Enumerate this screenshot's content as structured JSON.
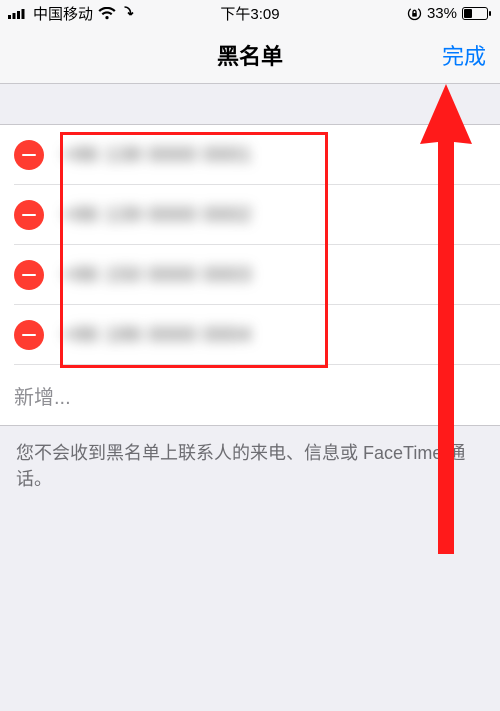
{
  "status": {
    "carrier": "中国移动",
    "time": "下午3:09",
    "battery_pct": "33%"
  },
  "nav": {
    "title": "黑名单",
    "done_label": "完成"
  },
  "list": {
    "items": [
      {
        "text": "+86 138 0000 0001"
      },
      {
        "text": "+86 139 0000 0002"
      },
      {
        "text": "+86 150 0000 0003"
      },
      {
        "text": "+86 186 0000 0004"
      }
    ],
    "add_label": "新增..."
  },
  "footer": {
    "note": "您不会收到黑名单上联系人的来电、信息或 FaceTime 通话。"
  },
  "annotations": {
    "box_color": "#ff1a1a",
    "arrow_color": "#ff1a1a"
  }
}
